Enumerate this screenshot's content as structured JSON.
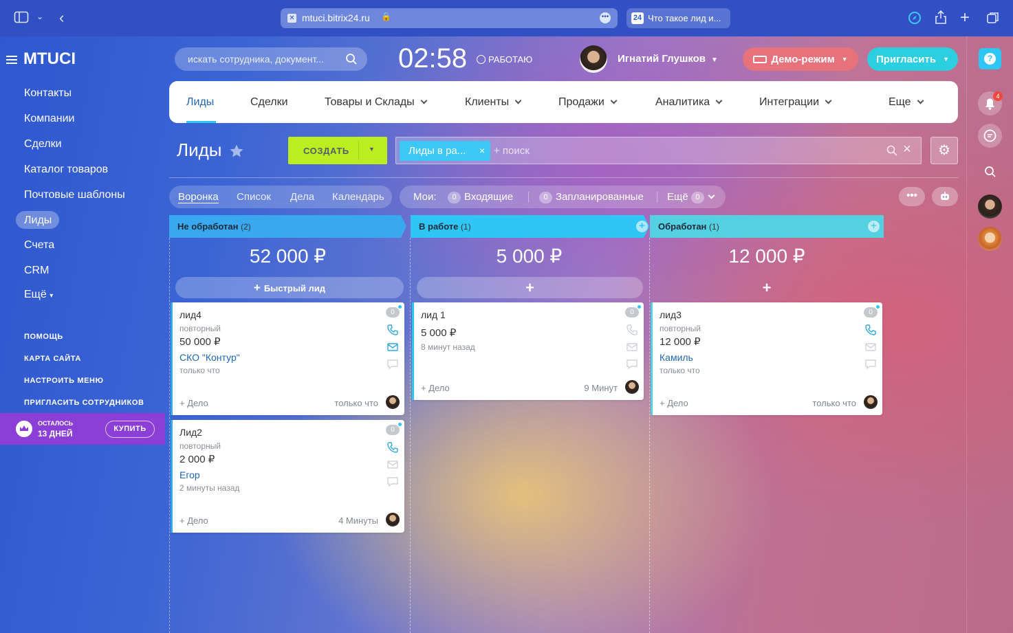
{
  "browser": {
    "url": "mtuci.bitrix24.ru",
    "tab_title": "Что такое лид и...",
    "tab_badge": "24"
  },
  "sidebar": {
    "brand": "MTUCI",
    "items": [
      {
        "label": "Контакты"
      },
      {
        "label": "Компании"
      },
      {
        "label": "Сделки"
      },
      {
        "label": "Каталог товаров"
      },
      {
        "label": "Почтовые шаблоны"
      },
      {
        "label": "Лиды",
        "active": true
      },
      {
        "label": "Счета"
      },
      {
        "label": "CRM"
      },
      {
        "label": "Ещё"
      }
    ],
    "links": [
      "ПОМОЩЬ",
      "КАРТА САЙТА",
      "НАСТРОИТЬ МЕНЮ",
      "ПРИГЛАСИТЬ СОТРУДНИКОВ"
    ],
    "trial": {
      "line1": "ОСТАЛОСЬ",
      "line2": "13 ДНЕЙ",
      "buy": "КУПИТЬ"
    }
  },
  "header": {
    "search_placeholder": "искать сотрудника, документ...",
    "time": "02:58",
    "status": "РАБОТАЮ",
    "user_name": "Игнатий Глушков",
    "demo": "Демо-режим",
    "invite": "Пригласить"
  },
  "topnav": {
    "items": [
      "Лиды",
      "Сделки",
      "Товары и Склады",
      "Клиенты",
      "Продажи",
      "Аналитика",
      "Интеграции",
      "Еще"
    ]
  },
  "page": {
    "title": "Лиды",
    "create_label": "СОЗДАТЬ",
    "filter_tag": "Лиды в ра...",
    "filter_placeholder": "+ поиск"
  },
  "views": {
    "tabs": [
      "Воронка",
      "Список",
      "Дела",
      "Календарь"
    ],
    "my_label": "Мои:",
    "incoming": {
      "count": "0",
      "label": "Входящие"
    },
    "planned": {
      "count": "0",
      "label": "Запланированные"
    },
    "more": {
      "label": "Ещё",
      "count": "0"
    }
  },
  "columns": [
    {
      "title": "Не обработан",
      "count": "(2)",
      "color": "#39a8ef",
      "sum": "52 000 ₽",
      "quick": "Быстрый лид",
      "cards": [
        {
          "title": "лид4",
          "type": "повторный",
          "price": "50 000 ₽",
          "link": "СКО \"Контур\"",
          "updated": "только что",
          "badge": "0",
          "delo": "+ Дело",
          "time": "только что"
        },
        {
          "title": "Лид2",
          "type": "повторный",
          "price": "2 000 ₽",
          "link": "Егор",
          "updated": "2 минуты назад",
          "badge": "0",
          "delo": "+ Дело",
          "time": "4 Минуты"
        }
      ]
    },
    {
      "title": "В работе",
      "count": "(1)",
      "color": "#2fc6f6",
      "sum": "5 000 ₽",
      "quick": "",
      "cards": [
        {
          "title": "лид 1",
          "type": "",
          "price": "5 000 ₽",
          "link": "",
          "updated": "8 минут назад",
          "badge": "0",
          "delo": "+ Дело",
          "time": "9 Минут"
        }
      ]
    },
    {
      "title": "Обработан",
      "count": "(1)",
      "color": "#55d0e0",
      "sum": "12 000 ₽",
      "quick": "",
      "cards": [
        {
          "title": "лид3",
          "type": "повторный",
          "price": "12 000 ₽",
          "link": "Камиль",
          "updated": "только что",
          "badge": "0",
          "delo": "+ Дело",
          "time": "только что"
        }
      ]
    }
  ],
  "rail": {
    "notifications": "4"
  }
}
